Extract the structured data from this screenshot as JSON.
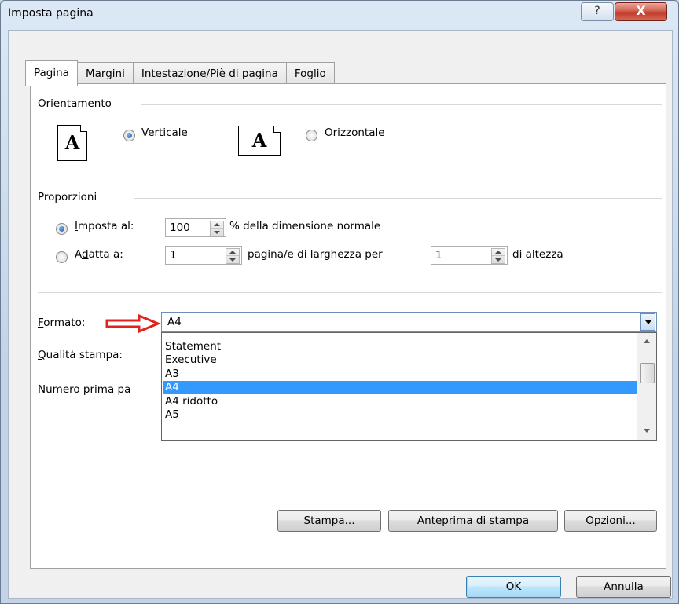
{
  "window": {
    "title": "Imposta pagina",
    "help_glyph": "?",
    "close_glyph": "X"
  },
  "tabs": [
    {
      "label": "Pagina",
      "active": true
    },
    {
      "label": "Margini",
      "active": false
    },
    {
      "label": "Intestazione/Piè di pagina",
      "active": false
    },
    {
      "label": "Foglio",
      "active": false
    }
  ],
  "orientation": {
    "group_label": "Orientamento",
    "portrait": {
      "label": "Verticale",
      "checked": true,
      "icon_glyph": "A"
    },
    "landscape": {
      "label": "Orizzontale",
      "checked": false,
      "icon_glyph": "A"
    }
  },
  "scaling": {
    "group_label": "Proporzioni",
    "adjust_to": {
      "label": "Imposta al:",
      "checked": true,
      "value": "100",
      "suffix": "% della dimensione normale"
    },
    "fit_to": {
      "label": "Adatta a:",
      "checked": false,
      "pages_wide": "1",
      "wide_suffix": "pagina/e di larghezza per",
      "pages_tall": "1",
      "tall_suffix": "di altezza"
    }
  },
  "paper": {
    "format_label": "Formato:",
    "format_value": "A4",
    "options": [
      "Statement",
      "Executive",
      "A3",
      "A4",
      "A4 ridotto",
      "A5"
    ],
    "selected": "A4",
    "quality_label": "Qualità stampa:",
    "first_page_label": "Numero prima pa"
  },
  "buttons": {
    "print": "Stampa...",
    "preview": "Anteprima di stampa",
    "options": "Opzioni...",
    "ok": "OK",
    "cancel": "Annulla"
  },
  "colors": {
    "annotation_arrow": "#e0231c",
    "selection": "#3399ff",
    "close_button": "#c0392b"
  },
  "icons": {
    "help": "help-icon",
    "close": "close-icon",
    "dropdown": "chevron-down-icon",
    "annotation": "red-arrow-icon"
  }
}
